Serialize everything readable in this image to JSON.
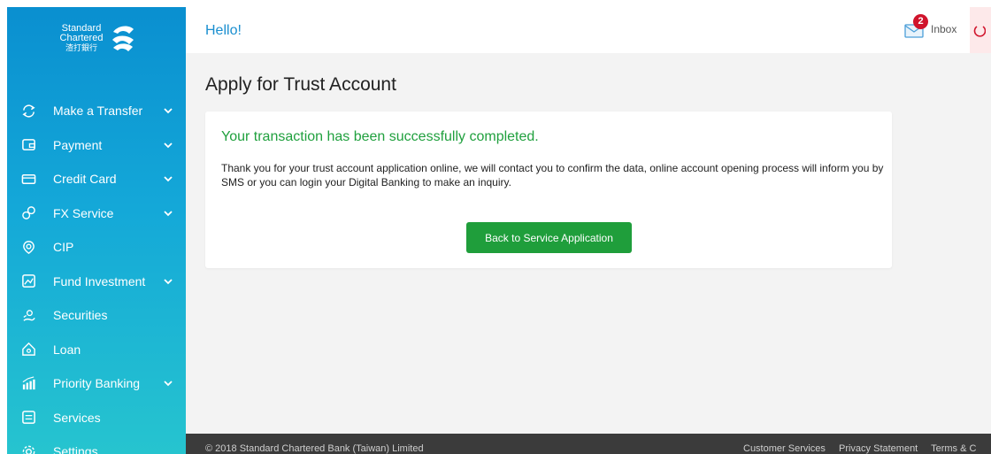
{
  "brand": {
    "line1": "Standard",
    "line2": "Chartered",
    "line3": "渣打銀行"
  },
  "sidebar": {
    "items": [
      {
        "label": "Make a Transfer",
        "icon": "transfer-icon",
        "expandable": true
      },
      {
        "label": "Payment",
        "icon": "payment-icon",
        "expandable": true
      },
      {
        "label": "Credit Card",
        "icon": "credit-card-icon",
        "expandable": true
      },
      {
        "label": "FX Service",
        "icon": "fx-icon",
        "expandable": true
      },
      {
        "label": "CIP",
        "icon": "cip-icon",
        "expandable": false
      },
      {
        "label": "Fund Investment",
        "icon": "fund-icon",
        "expandable": true
      },
      {
        "label": "Securities",
        "icon": "securities-icon",
        "expandable": false
      },
      {
        "label": "Loan",
        "icon": "loan-icon",
        "expandable": false
      },
      {
        "label": "Priority Banking",
        "icon": "priority-banking-icon",
        "expandable": true
      },
      {
        "label": "Services",
        "icon": "services-icon",
        "expandable": false
      },
      {
        "label": "Settings",
        "icon": "settings-icon",
        "expandable": false
      }
    ]
  },
  "header": {
    "greeting": "Hello!",
    "inbox_label": "Inbox",
    "inbox_count": "2"
  },
  "main": {
    "title": "Apply for Trust Account",
    "success_message": "Your transaction has been successfully completed.",
    "body_text": "Thank you for your trust account application online, we will contact you to confirm the data, online account opening process will inform you by SMS or you can login your Digital Banking to make an inquiry.",
    "button_label": "Back to Service Application"
  },
  "footer": {
    "copyright": "© 2018 Standard Chartered Bank (Taiwan) Limited",
    "links": [
      "Customer Services",
      "Privacy Statement",
      "Terms & C"
    ]
  },
  "colors": {
    "accent": "#1a8fd0",
    "success": "#20a03e",
    "button": "#1f9e3b",
    "badge": "#d0142c",
    "footer_bg": "#3b3b3b"
  }
}
